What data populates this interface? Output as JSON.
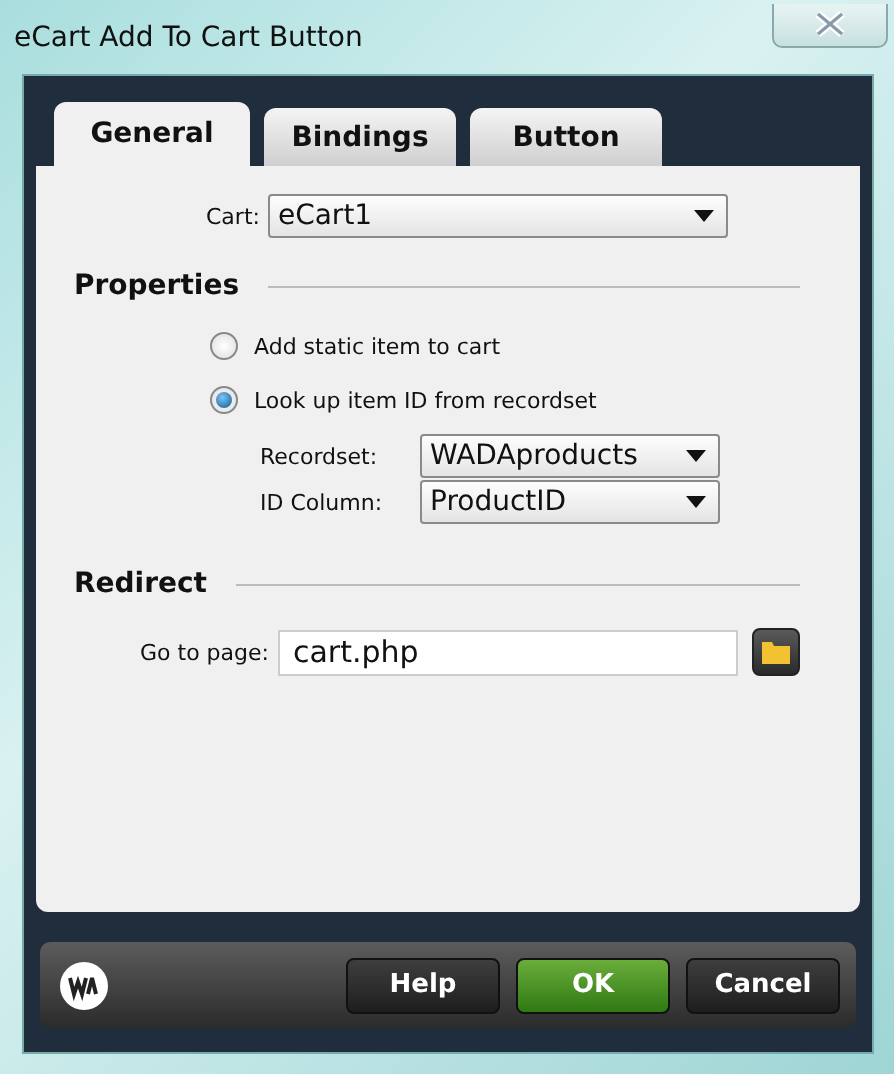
{
  "window": {
    "title": "eCart Add To Cart Button"
  },
  "tabs": [
    {
      "label": "General",
      "selected": true
    },
    {
      "label": "Bindings",
      "selected": false
    },
    {
      "label": "Button",
      "selected": false
    }
  ],
  "cart": {
    "label": "Cart:",
    "value": "eCart1"
  },
  "properties": {
    "heading": "Properties",
    "options": [
      {
        "label": "Add static item to cart",
        "selected": false
      },
      {
        "label": "Look up item ID from recordset",
        "selected": true
      }
    ],
    "fields": [
      {
        "label": "Recordset:",
        "value": "WADAproducts"
      },
      {
        "label": "ID Column:",
        "value": "ProductID"
      }
    ]
  },
  "redirect": {
    "heading": "Redirect",
    "label": "Go to page:",
    "value": "cart.php"
  },
  "buttons": [
    {
      "label": "Help",
      "kind": "normal"
    },
    {
      "label": "OK",
      "kind": "primary"
    },
    {
      "label": "Cancel",
      "kind": "normal"
    }
  ]
}
